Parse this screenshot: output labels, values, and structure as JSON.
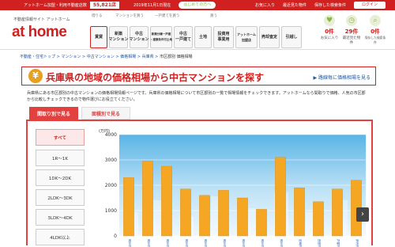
{
  "topbar": {
    "notice": "アットホーム加盟・利用不動産店数",
    "count": "55,821店",
    "date": "2019年11月1日現在",
    "beginner": "はじめての方へ",
    "links": [
      "お気に入り",
      "最近見た物件",
      "保存した検索条件"
    ],
    "login": "ログイン"
  },
  "header": {
    "subtitle": "不動産情報サイト アットホーム",
    "logo": "at home",
    "groups": [
      "借りる",
      "マンションを買う",
      "一戸建てを買う",
      "買う"
    ],
    "nav": [
      {
        "label": "賃貸",
        "active": true
      },
      {
        "label": "新築\nマンション",
        "active": false
      },
      {
        "label": "中古\nマンション",
        "active": false
      },
      {
        "label": "新築分譲一戸建\n・建築条件付土地",
        "active": false
      },
      {
        "label": "中古\n一戸建て",
        "active": false
      },
      {
        "label": "土地",
        "active": false
      },
      {
        "label": "投資用\n事業用",
        "active": false
      },
      {
        "label": "アットホーム\n加盟店",
        "active": false
      },
      {
        "label": "売却査定",
        "active": false
      },
      {
        "label": "引越し",
        "active": false
      }
    ],
    "util": [
      {
        "label": "お気に入り",
        "value": "0件"
      },
      {
        "label": "最近見た物件",
        "value": "29件"
      },
      {
        "label": "保存した検索条件",
        "value": "0件"
      }
    ]
  },
  "breadcrumb": {
    "items": [
      "不動産・住宅トップ",
      "マンション",
      "中古マンション",
      "価格相場",
      "兵庫県"
    ],
    "current": "市区郡別 価格相場"
  },
  "title": {
    "icon": "¥",
    "text": "兵庫県の地域の価格相場から中古マンションを探す",
    "link": "路線毎に価格相場を見る"
  },
  "description": "兵庫県にある市区郡別の中古マンションの価格相場情報ページです。兵庫県の価格相場について市区郡別の一覧で相場情報をチェックできます。アットホームなら間取りで価格、人気の市区郡から比較しチェックできるので物件選びにお役立てください。",
  "tabs": [
    "間取り別で見る",
    "面積別で見る"
  ],
  "sidebar": [
    {
      "label": "すべて",
      "active": true
    },
    {
      "label": "1R〜1K",
      "active": false
    },
    {
      "label": "1DK〜2DK",
      "active": false
    },
    {
      "label": "2LDK〜3DK",
      "active": false
    },
    {
      "label": "3LDK〜4DK",
      "active": false
    },
    {
      "label": "4LDK以上",
      "active": false
    }
  ],
  "chart_data": {
    "type": "bar",
    "ylabel": "(万円)",
    "ylim": [
      0,
      4000
    ],
    "yticks": [
      0,
      1000,
      2000,
      3000,
      4000
    ],
    "categories": [
      "神戸市東灘区",
      "神戸市灘区",
      "神戸市中央区",
      "神戸市兵庫区",
      "神戸市長田区",
      "神戸市須磨区",
      "神戸市垂水区",
      "神戸市北区",
      "神戸市西区",
      "尼崎市",
      "西宮市",
      "芦屋市",
      "伊丹市"
    ],
    "values": [
      2300,
      2950,
      2750,
      1850,
      1600,
      1800,
      1500,
      1050,
      3100,
      1900,
      1350,
      1850,
      2200
    ],
    "bar_color": "#f5a623",
    "grid": true
  }
}
